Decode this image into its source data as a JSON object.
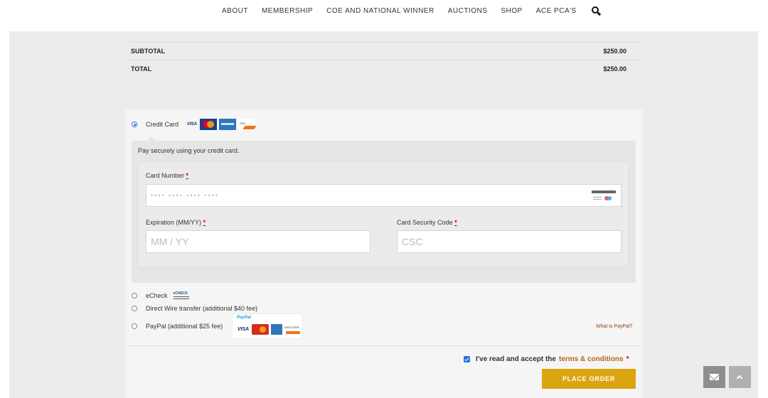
{
  "nav": {
    "items": [
      "ABOUT",
      "MEMBERSHIP",
      "COE AND NATIONAL WINNER",
      "AUCTIONS",
      "SHOP",
      "ACE PCA'S"
    ]
  },
  "totals": {
    "subtotal_label": "SUBTOTAL",
    "subtotal_value": "$250.00",
    "total_label": "TOTAL",
    "total_value": "$250.00"
  },
  "payment": {
    "credit_card": {
      "label": "Credit Card",
      "logos": [
        "VISA",
        "MasterCard",
        "American Express",
        "Discover"
      ],
      "description": "Pay securely using your credit card.",
      "card_number_label": "Card Number",
      "card_number_placeholder": "•••• •••• •••• ••••",
      "expiration_label": "Expiration (MM/YY)",
      "expiration_placeholder": "MM / YY",
      "csc_label": "Card Security Code",
      "csc_placeholder": "CSC",
      "required_mark": "*",
      "selected": true
    },
    "echeck": {
      "label": "eCheck",
      "logo_text": "eCHECK"
    },
    "wire": {
      "label": "Direct Wire transfer (additional $40 fee)"
    },
    "paypal": {
      "label": "PayPal (additional $25 fee)",
      "logo_text_a": "Pay",
      "logo_text_b": "Pal",
      "visa_text": "VISA",
      "discover_text": "DISCOVER",
      "what_link": "What is PayPal?"
    }
  },
  "terms": {
    "text": "I've read and accept the",
    "link": "terms & conditions",
    "required_mark": "*",
    "checked": true
  },
  "place_order": "PLACE ORDER",
  "colors": {
    "accent": "#dba510",
    "link": "#b5651d",
    "radio_checked": "#2a6ee0",
    "required": "#cc0000"
  },
  "icons": [
    "search-icon",
    "card-generic-icon",
    "mail-icon",
    "chevron-up-icon"
  ]
}
